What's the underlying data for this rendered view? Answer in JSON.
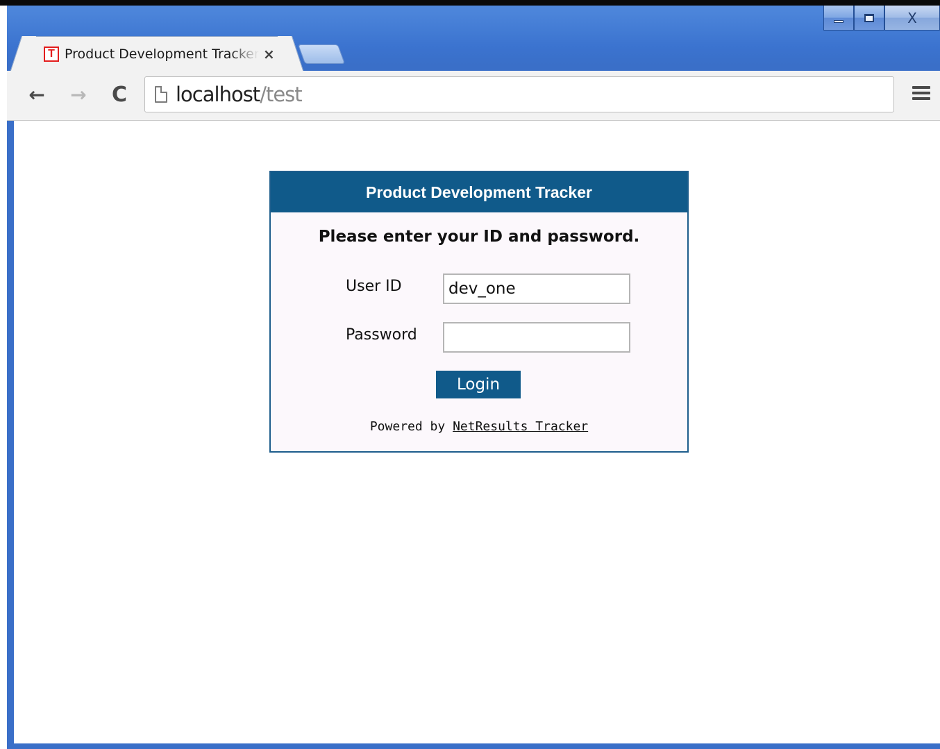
{
  "browser": {
    "tab": {
      "favicon_letter": "T",
      "title": "Product Development Tracker",
      "close_glyph": "×"
    },
    "caption": {
      "close_glyph": "X"
    },
    "toolbar": {
      "back_glyph": "←",
      "forward_glyph": "→",
      "reload_glyph": "C",
      "url_host": "localhost",
      "url_path": "/test"
    }
  },
  "page": {
    "header": "Product Development Tracker",
    "prompt": "Please enter your ID and password.",
    "user_label": "User ID",
    "user_value": "dev_one",
    "password_label": "Password",
    "password_value": "",
    "login_label": "Login",
    "powered_prefix": "Powered by ",
    "powered_link": "NetResults Tracker"
  },
  "colors": {
    "header_bg": "#105a8a",
    "box_border": "#1d5d8c",
    "favicon": "#e31d1d",
    "frame": "#3a6fc8"
  }
}
